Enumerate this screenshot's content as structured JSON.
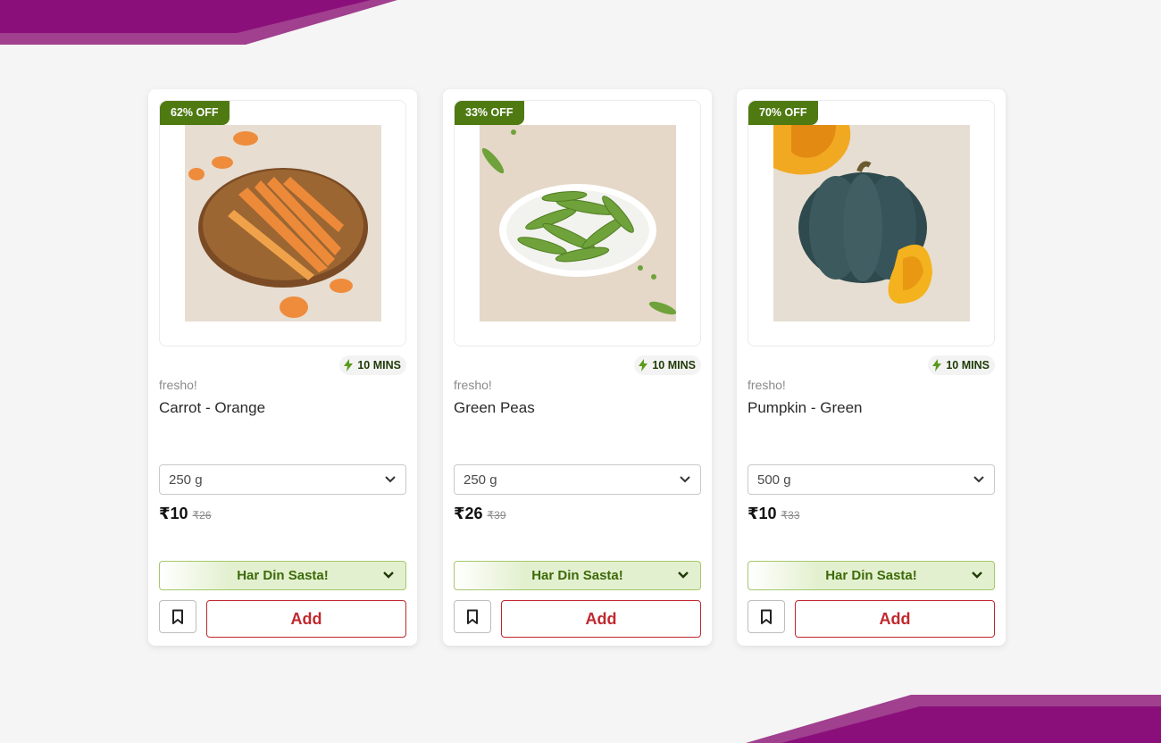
{
  "theme": {
    "accent": "#8b0f7a",
    "badge_green": "#4f7a12",
    "add_red": "#c0282e",
    "offer_green": "#3d6a0a"
  },
  "products": [
    {
      "discount": "62% OFF",
      "eta": "10 MINS",
      "brand": "fresho!",
      "name": "Carrot - Orange",
      "image": "carrots-on-wooden-board",
      "quantity": "250 g",
      "price": "₹10",
      "mrp": "₹26",
      "offer": "Har Din Sasta!",
      "add_label": "Add"
    },
    {
      "discount": "33% OFF",
      "eta": "10 MINS",
      "brand": "fresho!",
      "name": "Green Peas",
      "image": "green-peas-in-bowl",
      "quantity": "250 g",
      "price": "₹26",
      "mrp": "₹39",
      "offer": "Har Din Sasta!",
      "add_label": "Add"
    },
    {
      "discount": "70% OFF",
      "eta": "10 MINS",
      "brand": "fresho!",
      "name": "Pumpkin - Green",
      "image": "green-pumpkin-halved",
      "quantity": "500 g",
      "price": "₹10",
      "mrp": "₹33",
      "offer": "Har Din Sasta!",
      "add_label": "Add"
    }
  ]
}
